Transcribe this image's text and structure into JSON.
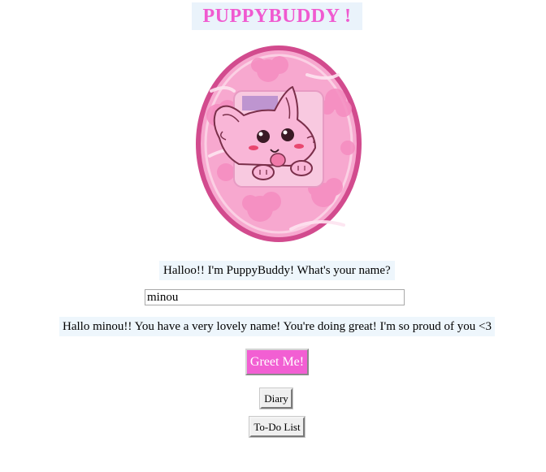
{
  "header": {
    "title": "PUPPYBUDDY !"
  },
  "mascot": {
    "icon": "puppy-egg-icon",
    "colors": {
      "shell": "#f7a8cf",
      "rim": "#d24b8e",
      "screen": "#f8c9e0",
      "accent": "#f05ad0"
    }
  },
  "prompt": {
    "text": "Halloo!! I'm PuppyBuddy! What's your name?"
  },
  "name_input": {
    "value": "minou"
  },
  "greeting": {
    "text": "Hallo minou!! You have a very lovely name! You're doing great! I'm so proud of you <3"
  },
  "buttons": {
    "greet_label": "Greet Me!",
    "diary_label": "Diary",
    "todo_label": "To-Do List"
  }
}
